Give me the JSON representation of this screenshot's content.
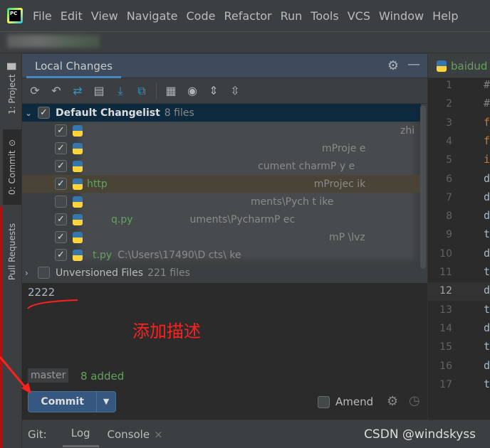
{
  "menu": [
    "File",
    "Edit",
    "View",
    "Navigate",
    "Code",
    "Refactor",
    "Run",
    "Tools",
    "VCS",
    "Window",
    "Help"
  ],
  "sidebar": {
    "project": "1: Project",
    "commit": "0: Commit",
    "pull_requests": "Pull Requests"
  },
  "panel": {
    "tab": "Local Changes"
  },
  "toolbar_icons": [
    "refresh-icon",
    "rollback-icon",
    "diff-icon",
    "changelist-icon",
    "update-icon",
    "shelve-icon",
    "group-icon",
    "eye-icon",
    "expand-all-icon",
    "collapse-all-icon"
  ],
  "tree": {
    "changelist": {
      "label": "Default Changelist",
      "count": "8 files"
    },
    "files": [
      {
        "name": "",
        "path": "zhi"
      },
      {
        "name": "",
        "path": "mProje      e"
      },
      {
        "name": "",
        "path": "cument    charmP y    e"
      },
      {
        "name": "http",
        "path": "mProjec    ik"
      },
      {
        "name": "",
        "path": "ments\\Pych      t    ike"
      },
      {
        "name": "q.py",
        "path": "uments\\PycharmP   ec"
      },
      {
        "name": "",
        "path": "mP      \\lvz"
      },
      {
        "name": "t.py",
        "path": "C:\\Users\\17490\\D          cts\\   ke"
      }
    ],
    "unversioned": {
      "label": "Unversioned Files",
      "count": "221 files"
    }
  },
  "commit_message": "2222",
  "annotation": "添加描述",
  "branch": "master",
  "status": "8 added",
  "commit_button": "Commit",
  "amend_label": "Amend",
  "editor": {
    "tab": "baidud",
    "lines": [
      "1",
      "2",
      "3",
      "4",
      "5",
      "6",
      "7",
      "8",
      "9",
      "10",
      "11",
      "12",
      "13",
      "14",
      "15",
      "16",
      "17"
    ],
    "code": [
      "#",
      "#",
      "f",
      "f",
      "i",
      "d",
      "d",
      "d",
      "t",
      "d",
      "t",
      "d",
      "t",
      "d",
      "t",
      "d",
      "t"
    ],
    "current_line": "12"
  },
  "bottom": {
    "git": "Git:",
    "log": "Log",
    "console": "Console"
  },
  "watermark": "CSDN @windskyss",
  "colors": {
    "accent": "#4a88c7",
    "added": "#62a35c",
    "annotation": "#ff2020",
    "commit_button": "#365880"
  }
}
